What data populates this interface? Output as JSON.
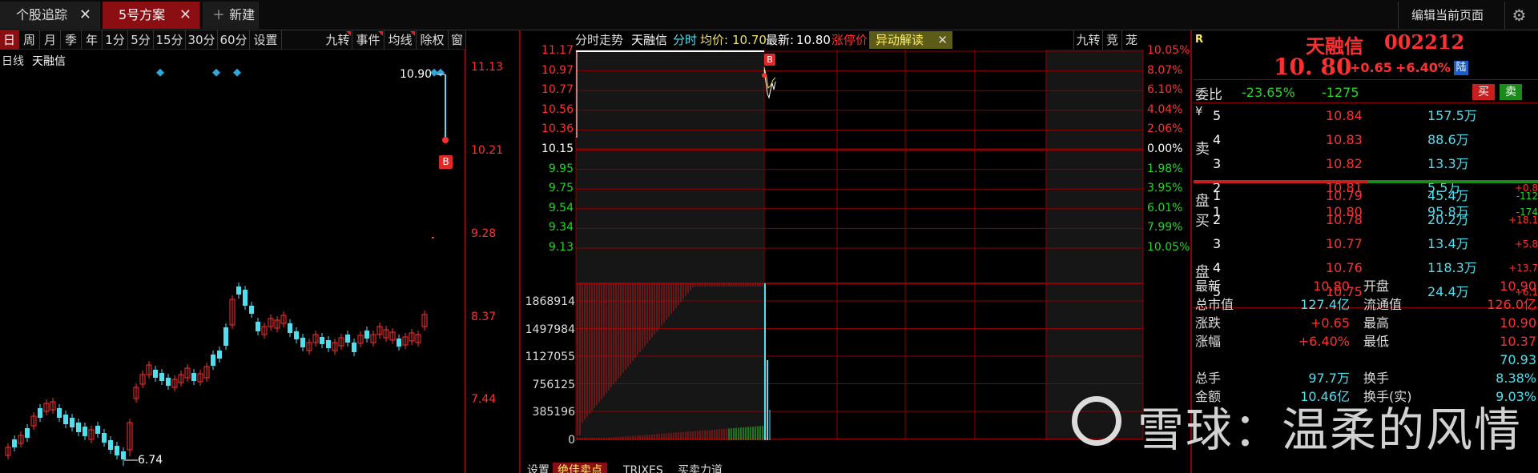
{
  "tabs": [
    {
      "label": "个股追踪",
      "close": "✕"
    },
    {
      "label": "5号方案",
      "close": "✕"
    },
    {
      "label": "新建",
      "icon": "plus-icon"
    }
  ],
  "header": {
    "edit_page": "编辑当前页面",
    "settings_icon": "gear-icon"
  },
  "period_bar": {
    "items": [
      "日",
      "周",
      "月",
      "季",
      "年",
      "1分",
      "5分",
      "15分",
      "30分",
      "60分",
      "设置",
      "九转",
      "事件",
      "均线",
      "除权",
      "窗"
    ],
    "selected": "日"
  },
  "kline": {
    "mode_label": "日线",
    "stock_name": "天融信",
    "price_axis": [
      "11.13",
      "10.21",
      "9.28",
      "8.37",
      "7.44"
    ],
    "high_label": "10.90",
    "low_label": "6.74",
    "buy_marker": "B"
  },
  "intraday": {
    "title": "分时走势",
    "stock_name": "天融信",
    "mode": "分时",
    "avg_label": "均价:",
    "avg_value": "10.70",
    "latest_label": "最新:",
    "latest_value": "10.80",
    "limit_label": "涨停价",
    "anomaly_button": "异动解读",
    "right_tags": [
      "九转",
      "竞",
      "茏"
    ],
    "price_left": [
      "11.17",
      "10.97",
      "10.77",
      "10.56",
      "10.36",
      "10.15",
      "9.95",
      "9.75",
      "9.54",
      "9.34",
      "9.13"
    ],
    "pct_right": [
      "10.05%",
      "8.07%",
      "6.10%",
      "4.04%",
      "2.06%",
      "0.00%",
      "1.98%",
      "3.95%",
      "6.01%",
      "7.99%",
      "10.05%"
    ],
    "volume_axis": [
      "1868914",
      "1497984",
      "1127055",
      "756125",
      "385196",
      "0"
    ],
    "marker": "B"
  },
  "bottom_tabs": [
    "设置",
    "绝佳卖点",
    "TRIXES",
    "买卖力道"
  ],
  "quote": {
    "flag": "R",
    "name": "天融信",
    "code": "002212",
    "price": "10. 80",
    "change": "+0.65",
    "pct": "+6.40%",
    "market": "陆",
    "weibi_label": "委比",
    "weibi_pct": "-23.65%",
    "weibi_val": "-1275",
    "buy_btn": "买",
    "sell_btn": "卖",
    "sell_side_label": [
      "卖",
      "盘"
    ],
    "buy_side_label": [
      "买",
      "盘"
    ],
    "currency": "¥",
    "asks": [
      {
        "level": "5",
        "price": "10.84",
        "vol": "157.5万",
        "delta": ""
      },
      {
        "level": "4",
        "price": "10.83",
        "vol": "88.6万",
        "delta": ""
      },
      {
        "level": "3",
        "price": "10.82",
        "vol": "13.3万",
        "delta": ""
      },
      {
        "level": "2",
        "price": "10.81",
        "vol": "5.5万",
        "delta": "+0.8"
      },
      {
        "level": "1",
        "price": "10.80",
        "vol": "95.8万",
        "delta": "-174"
      }
    ],
    "bids": [
      {
        "level": "1",
        "price": "10.79",
        "vol": "45.4万",
        "delta": "-112"
      },
      {
        "level": "2",
        "price": "10.78",
        "vol": "20.2万",
        "delta": "+18.1"
      },
      {
        "level": "3",
        "price": "10.77",
        "vol": "13.4万",
        "delta": "+5.8"
      },
      {
        "level": "4",
        "price": "10.76",
        "vol": "118.3万",
        "delta": "+13.7"
      },
      {
        "level": "5",
        "price": "10.75",
        "vol": "24.4万",
        "delta": "+6.1"
      }
    ],
    "stats": [
      {
        "l1": "最新",
        "v1": "10.80",
        "l2": "开盘",
        "v2": "10.90"
      },
      {
        "l1": "总市值",
        "v1": "127.4亿",
        "l2": "流通值",
        "v2": "126.0亿"
      },
      {
        "l1": "涨跌",
        "v1": "+0.65",
        "l2": "最高",
        "v2": "10.90"
      },
      {
        "l1": "涨幅",
        "v1": "+6.40%",
        "l2": "最低",
        "v2": "10.37"
      },
      {
        "l1": "",
        "v1": "",
        "l2": "",
        "v2": "70.93"
      },
      {
        "l1": "总手",
        "v1": "97.7万",
        "l2": "换手",
        "v2": "8.38%"
      },
      {
        "l1": "金额",
        "v1": "10.46亿",
        "l2": "换手(实)",
        "v2": "9.03%"
      }
    ]
  },
  "watermark": "雪球：温柔的风情",
  "colors": {
    "up": "#ff3030",
    "down": "#22d822",
    "cyan": "#4fe0f0",
    "grid": "#8b0000",
    "tab_active": "#8b0e12"
  }
}
